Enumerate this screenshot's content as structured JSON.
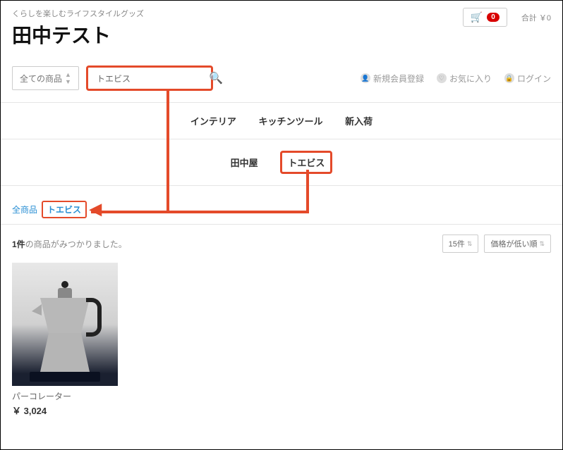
{
  "header": {
    "tagline": "くらしを楽しむライフスタイルグッズ",
    "site_title": "田中テスト",
    "cart_count": "0",
    "total_label": "合計 ￥0"
  },
  "search": {
    "category_select": "全ての商品",
    "query": "トエビス"
  },
  "util_nav": {
    "register": "新規会員登録",
    "favorites": "お気に入り",
    "login": "ログイン"
  },
  "nav1": {
    "interior": "インテリア",
    "kitchen": "キッチンツール",
    "new": "新入荷"
  },
  "nav2": {
    "brand1": "田中屋",
    "brand2": "トエビス"
  },
  "breadcrumb": {
    "all": "全商品",
    "current": "トエビス"
  },
  "results": {
    "count_num": "1件",
    "count_tail": "の商品がみつかりました。",
    "per_page": "15件",
    "sort": "価格が低い順"
  },
  "product": {
    "name": "パーコレーター",
    "price": "￥ 3,024"
  }
}
